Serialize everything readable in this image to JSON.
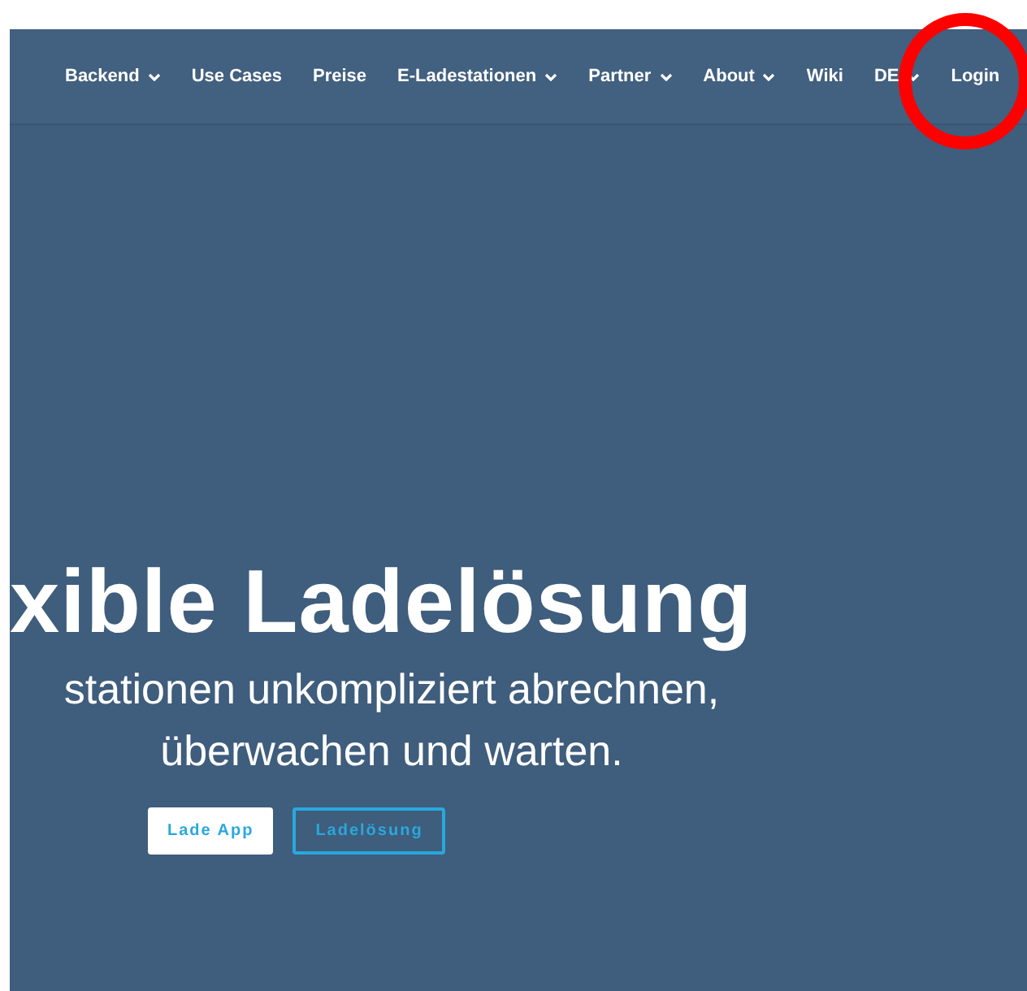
{
  "nav": {
    "items": [
      {
        "label": "Backend",
        "dropdown": true
      },
      {
        "label": "Use Cases",
        "dropdown": false
      },
      {
        "label": "Preise",
        "dropdown": false
      },
      {
        "label": "E-Ladestationen",
        "dropdown": true
      },
      {
        "label": "Partner",
        "dropdown": true
      },
      {
        "label": "About",
        "dropdown": true
      },
      {
        "label": "Wiki",
        "dropdown": false
      },
      {
        "label": "DE",
        "dropdown": true
      },
      {
        "label": "Login",
        "dropdown": false
      }
    ]
  },
  "hero": {
    "headline": "xible Ladelösung",
    "subtitle_lines": [
      "stationen unkompliziert abrechnen,",
      "überwachen und warten."
    ],
    "buttons": [
      {
        "label": "Lade App",
        "kind": "filled"
      },
      {
        "label": "Ladelösung",
        "kind": "outline"
      }
    ]
  }
}
